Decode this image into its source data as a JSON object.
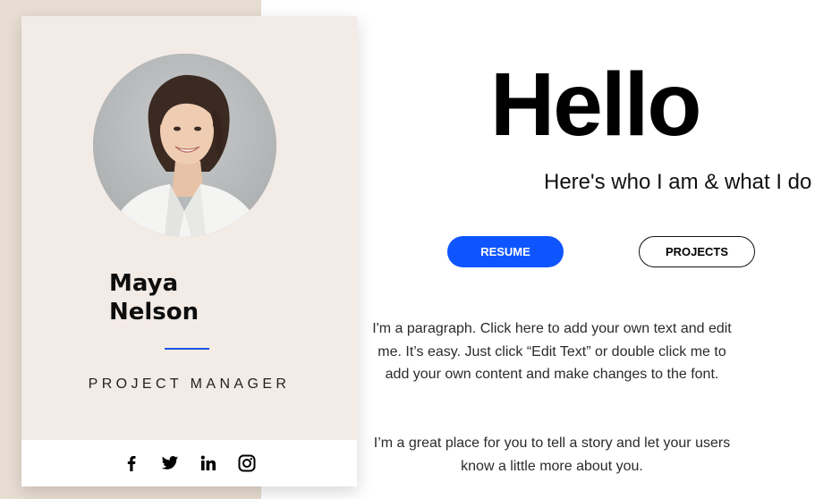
{
  "profile": {
    "name_first": "Maya",
    "name_last": "Nelson",
    "role": "PROJECT MANAGER"
  },
  "social": [
    {
      "icon": "facebook-icon"
    },
    {
      "icon": "twitter-icon"
    },
    {
      "icon": "linkedin-icon"
    },
    {
      "icon": "instagram-icon"
    }
  ],
  "hero": {
    "greeting": "Hello",
    "subtitle": "Here's who I am & what I do"
  },
  "buttons": {
    "resume": "RESUME",
    "projects": "PROJECTS"
  },
  "about": {
    "paragraph1": "I'm a paragraph. Click here to add your own text and edit me. It’s easy. Just click “Edit Text” or double click me to add your own content and make changes to the font.",
    "paragraph2": "I’m a great place for you to tell a story and let your users know a little more about you."
  },
  "colors": {
    "accent": "#0f55ff",
    "card_background": "#f3ebe6",
    "page_left_background": "#e8ddd3",
    "divider": "#1d56e0"
  }
}
